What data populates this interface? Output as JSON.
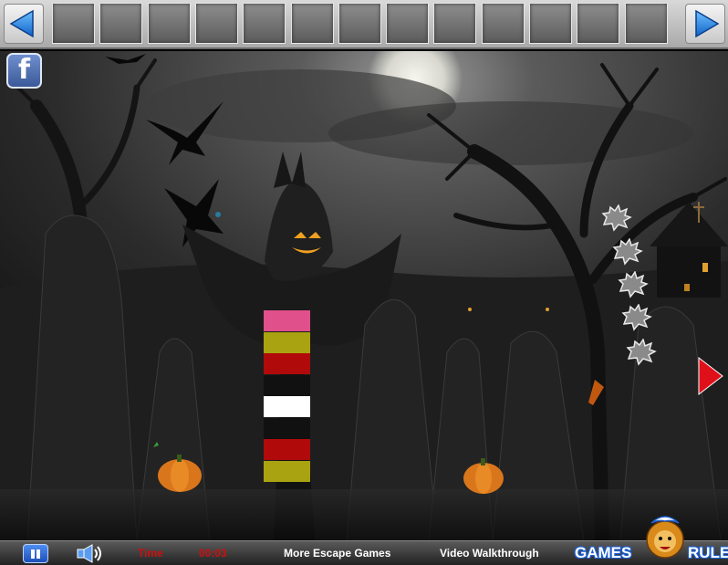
{
  "top_bar": {
    "left_arrow_icon": "left-triangle-icon",
    "right_arrow_icon": "right-triangle-icon",
    "accent": "#1f7fe0",
    "inventory_slot_count": 13
  },
  "scene": {
    "facebook_label": "f",
    "stripe_colors": [
      "#e0508a",
      "#a9a211",
      "#b00a0a",
      "#111111",
      "#ffffff",
      "#111111",
      "#b00a0a",
      "#a9a211"
    ],
    "leaf_count": 5,
    "leaf_icon": "leaf-silhouette-icon",
    "right_arrow_color": "#e0101a",
    "pumpkin_icon": "pumpkin-icon"
  },
  "bottom_bar": {
    "pause_icon": "pause-icon",
    "sound_icon": "speaker-icon",
    "time_label": "Time",
    "time_value": "00:03",
    "more_games": "More Escape Games",
    "walkthrough": "Video Walkthrough",
    "logo_left": "GAMES",
    "logo_right": "RULE"
  }
}
